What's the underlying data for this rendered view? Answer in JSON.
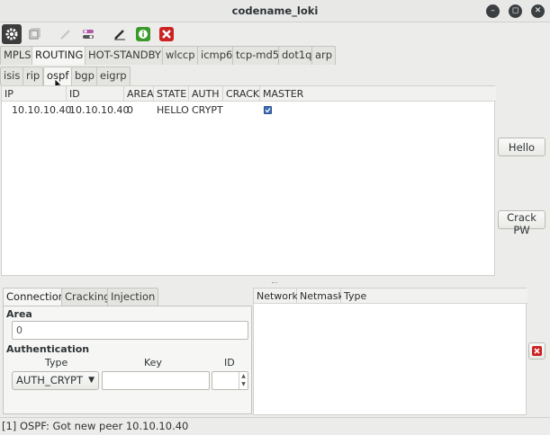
{
  "window": {
    "title": "codename_loki"
  },
  "main_tabs": [
    "MPLS",
    "ROUTING",
    "HOT-STANDBY",
    "wlccp",
    "icmp6",
    "tcp-md5",
    "dot1q",
    "arp"
  ],
  "routing_tabs": [
    "isis",
    "rip",
    "ospf",
    "bgp",
    "eigrp"
  ],
  "peers_table": {
    "headers": [
      "IP",
      "ID",
      "AREA",
      "STATE",
      "AUTH",
      "CRACK",
      "MASTER"
    ],
    "rows": [
      {
        "ip": "10.10.10.40",
        "id": "10.10.10.40",
        "area": "0",
        "state": "HELLO",
        "auth": "CRYPT",
        "crack": "",
        "master": true
      }
    ]
  },
  "side_buttons": {
    "hello": "Hello",
    "crack_pw": "Crack PW"
  },
  "bottom_tabs": [
    "Connection",
    "Cracking",
    "Injection"
  ],
  "connection": {
    "area_label": "Area",
    "area_value": "0",
    "auth_label": "Authentication",
    "type_label": "Type",
    "key_label": "Key",
    "id_label": "ID",
    "type_value": "AUTH_CRYPT",
    "key_value": "",
    "id_value": ""
  },
  "networks_table": {
    "headers": [
      "Network",
      "Netmask",
      "Type"
    ]
  },
  "status": {
    "text": "[1] OSPF: Got new peer 10.10.10.40"
  },
  "colors": {
    "checkbox": "#3d6fb6",
    "delete_red": "#cc2222",
    "info_green": "#3a9a2a"
  }
}
